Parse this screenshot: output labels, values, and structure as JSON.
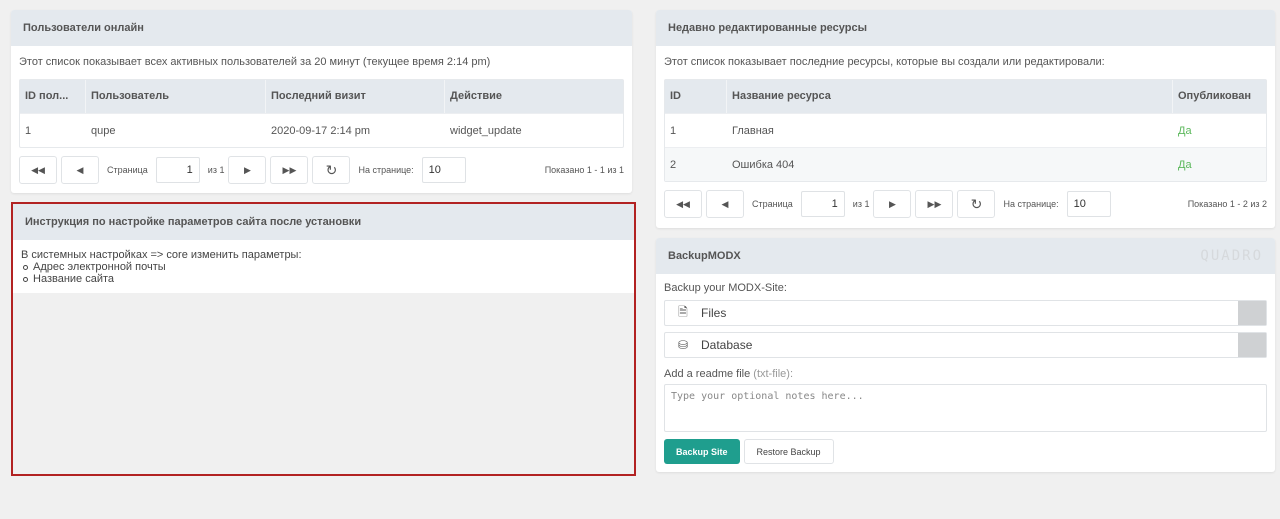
{
  "online_users": {
    "title": "Пользователи онлайн",
    "description": "Этот список показывает всех активных пользователей за 20 минут (текущее время 2:14 pm)",
    "columns": [
      "ID пол...",
      "Пользователь",
      "Последний визит",
      "Действие"
    ],
    "rows": [
      {
        "id": "1",
        "user": "qupe",
        "last_visit": "2020-09-17 2:14 pm",
        "action": "widget_update"
      }
    ],
    "pager": {
      "page_label": "Страница",
      "page_value": "1",
      "of_label": "из 1",
      "per_page_label": "На странице:",
      "per_page_value": "10",
      "info": "Показано 1 - 1 из 1"
    }
  },
  "recent_resources": {
    "title": "Недавно редактированные ресурсы",
    "description": "Этот список показывает последние ресурсы, которые вы создали или редактировали:",
    "columns": [
      "ID",
      "Название ресурса",
      "Опубликован"
    ],
    "rows": [
      {
        "id": "1",
        "name": "Главная",
        "published": "Да"
      },
      {
        "id": "2",
        "name": "Ошибка 404",
        "published": "Да"
      }
    ],
    "pager": {
      "page_label": "Страница",
      "page_value": "1",
      "of_label": "из 1",
      "per_page_label": "На странице:",
      "per_page_value": "10",
      "info": "Показано 1 - 2 из 2"
    }
  },
  "instructions": {
    "title": "Инструкция по настройке параметров сайта после установки",
    "intro": "В системных настройках => core изменить параметры:",
    "items": [
      "Адрес электронной почты",
      "Название сайта"
    ]
  },
  "backup": {
    "title": "BackupMODX",
    "brand": "QUADRO",
    "subtitle": "Backup your MODX-Site:",
    "files_label": "Files",
    "database_label": "Database",
    "readme_label": "Add a readme file",
    "readme_note": "(txt-file):",
    "readme_placeholder": "Type your optional notes here...",
    "backup_button": "Backup Site",
    "restore_button": "Restore Backup"
  },
  "colors": {
    "accent": "#1f9e8e",
    "published": "#5cb85c",
    "highlight_border": "#b22222"
  }
}
